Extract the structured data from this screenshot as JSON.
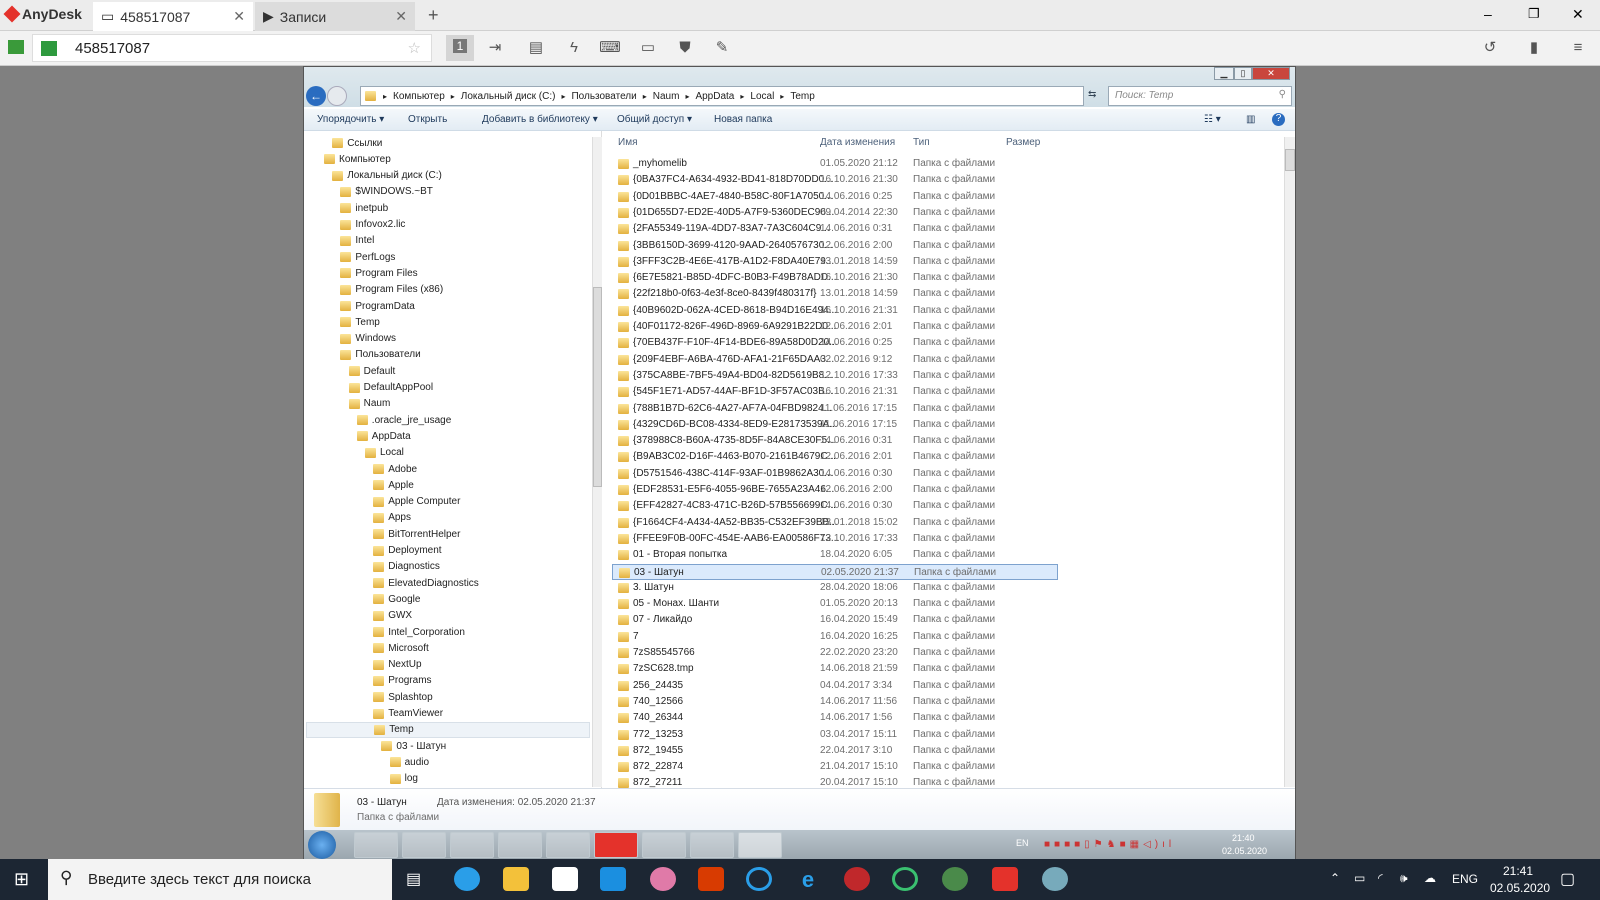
{
  "anydesk": {
    "app_name": "AnyDesk",
    "tabs": [
      {
        "label": "458517087"
      },
      {
        "label": "Записи"
      }
    ],
    "address_value": "458517087",
    "accent": "#e4322b",
    "display_number": "1"
  },
  "explorer": {
    "breadcrumb": [
      "Компьютер",
      "Локальный диск (C:)",
      "Пользователи",
      "Naum",
      "AppData",
      "Local",
      "Temp"
    ],
    "search_placeholder": "Поиск: Temp",
    "commands": [
      "Упорядочить ▾",
      "Открыть",
      "Добавить в библиотеку ▾",
      "Общий доступ ▾",
      "Новая папка"
    ],
    "columns": [
      "Имя",
      "Дата изменения",
      "Тип",
      "Размер"
    ],
    "tree": [
      {
        "label": "Ссылки",
        "depth": 1
      },
      {
        "label": "Компьютер",
        "depth": 0
      },
      {
        "label": "Локальный диск (C:)",
        "depth": 1
      },
      {
        "label": "$WINDOWS.~BT",
        "depth": 2
      },
      {
        "label": "inetpub",
        "depth": 2
      },
      {
        "label": "Infovox2.lic",
        "depth": 2
      },
      {
        "label": "Intel",
        "depth": 2
      },
      {
        "label": "PerfLogs",
        "depth": 2
      },
      {
        "label": "Program Files",
        "depth": 2
      },
      {
        "label": "Program Files (x86)",
        "depth": 2
      },
      {
        "label": "ProgramData",
        "depth": 2
      },
      {
        "label": "Temp",
        "depth": 2
      },
      {
        "label": "Windows",
        "depth": 2
      },
      {
        "label": "Пользователи",
        "depth": 2
      },
      {
        "label": "Default",
        "depth": 3
      },
      {
        "label": "DefaultAppPool",
        "depth": 3
      },
      {
        "label": "Naum",
        "depth": 3
      },
      {
        "label": ".oracle_jre_usage",
        "depth": 4
      },
      {
        "label": "AppData",
        "depth": 4
      },
      {
        "label": "Local",
        "depth": 5
      },
      {
        "label": "Adobe",
        "depth": 6
      },
      {
        "label": "Apple",
        "depth": 6
      },
      {
        "label": "Apple Computer",
        "depth": 6
      },
      {
        "label": "Apps",
        "depth": 6
      },
      {
        "label": "BitTorrentHelper",
        "depth": 6
      },
      {
        "label": "Deployment",
        "depth": 6
      },
      {
        "label": "Diagnostics",
        "depth": 6
      },
      {
        "label": "ElevatedDiagnostics",
        "depth": 6
      },
      {
        "label": "Google",
        "depth": 6
      },
      {
        "label": "GWX",
        "depth": 6
      },
      {
        "label": "Intel_Corporation",
        "depth": 6
      },
      {
        "label": "Microsoft",
        "depth": 6
      },
      {
        "label": "NextUp",
        "depth": 6
      },
      {
        "label": "Programs",
        "depth": 6
      },
      {
        "label": "Splashtop",
        "depth": 6
      },
      {
        "label": "TeamViewer",
        "depth": 6
      },
      {
        "label": "Temp",
        "depth": 6,
        "selected": true
      },
      {
        "label": "03 - Шатун",
        "depth": 7
      },
      {
        "label": "audio",
        "depth": 8
      },
      {
        "label": "log",
        "depth": 8
      }
    ],
    "files": [
      [
        "_myhomelib",
        "01.05.2020 21:12"
      ],
      [
        "{0BA37FC4-A634-4932-BD41-818D70DD0...",
        "16.10.2016 21:30"
      ],
      [
        "{0D01BBBC-4AE7-4840-B58C-80F1A7050...",
        "14.06.2016 0:25"
      ],
      [
        "{01D655D7-ED2E-40D5-A7F9-5360DEC96...",
        "09.04.2014 22:30"
      ],
      [
        "{2FA55349-119A-4DD7-83A7-7A3C604C9...",
        "14.06.2016 0:31"
      ],
      [
        "{3BB6150D-3699-4120-9AAD-2640576730...",
        "12.06.2016 2:00"
      ],
      [
        "{3FFF3C2B-4E6E-417B-A1D2-F8DA40E79...",
        "13.01.2018 14:59"
      ],
      [
        "{6E7E5821-B85D-4DFC-B0B3-F49B78ADD...",
        "16.10.2016 21:30"
      ],
      [
        "{22f218b0-0f63-4e3f-8ce0-8439f480317f}",
        "13.01.2018 14:59"
      ],
      [
        "{40B9602D-062A-4CED-8618-B94D16E494...",
        "16.10.2016 21:31"
      ],
      [
        "{40F01172-826F-496D-8969-6A9291B22D0...",
        "12.06.2016 2:01"
      ],
      [
        "{70EB437F-F10F-4F14-BDE6-89A58D0D20...",
        "14.06.2016 0:25"
      ],
      [
        "{209F4EBF-A6BA-476D-AFA1-21F65DAA3...",
        "02.02.2016 9:12"
      ],
      [
        "{375CA8BE-7BF5-49A4-BD04-82D5619B8...",
        "12.10.2016 17:33"
      ],
      [
        "{545F1E71-AD57-44AF-BF1D-3F57AC03B...",
        "16.10.2016 21:31"
      ],
      [
        "{788B1B7D-62C6-4A27-AF7A-04FBD9824...",
        "11.06.2016 17:15"
      ],
      [
        "{4329CD6D-BC08-4334-8ED9-E28173539A...",
        "11.06.2016 17:15"
      ],
      [
        "{378988C8-B60A-4735-8D5F-84A8CE30F5...",
        "14.06.2016 0:31"
      ],
      [
        "{B9AB3C02-D16F-4463-B070-2161B4679C...",
        "12.06.2016 2:01"
      ],
      [
        "{D5751546-438C-414F-93AF-01B9862A30...",
        "14.06.2016 0:30"
      ],
      [
        "{EDF28531-E5F6-4055-96BE-7655A23A46...",
        "12.06.2016 2:00"
      ],
      [
        "{EFF42827-4C83-471C-B26D-57B556699C...",
        "14.06.2016 0:30"
      ],
      [
        "{F1664CF4-A434-4A52-BB35-C532EF39BB...",
        "13.01.2018 15:02"
      ],
      [
        "{FFEE9F0B-00FC-454E-AAB6-EA00586F73...",
        "12.10.2016 17:33"
      ],
      [
        "01 - Вторая попытка",
        "18.04.2020 6:05"
      ],
      [
        "03 - Шатун",
        "02.05.2020 21:37"
      ],
      [
        "3. Шатун",
        "28.04.2020 18:06"
      ],
      [
        "05 - Монах. Шанти",
        "01.05.2020 20:13"
      ],
      [
        "07 - Ликайдо",
        "16.04.2020 15:49"
      ],
      [
        "7",
        "16.04.2020 16:25"
      ],
      [
        "7zS85545766",
        "22.02.2020 23:20"
      ],
      [
        "7zSC628.tmp",
        "14.06.2018 21:59"
      ],
      [
        "256_24435",
        "04.04.2017 3:34"
      ],
      [
        "740_12566",
        "14.06.2017 11:56"
      ],
      [
        "740_26344",
        "14.06.2017 1:56"
      ],
      [
        "772_13253",
        "03.04.2017 15:11"
      ],
      [
        "872_19455",
        "22.04.2017 3:10"
      ],
      [
        "872_22874",
        "21.04.2017 15:10"
      ],
      [
        "872_27211",
        "20.04.2017 15:10"
      ]
    ],
    "file_type": "Папка с файлами",
    "selected_index": 25,
    "details": {
      "name": "03 - Шатун",
      "type": "Папка с файлами",
      "modified_label": "Дата изменения: 02.05.2020 21:37"
    }
  },
  "remote_taskbar": {
    "lang": "EN",
    "time": "21:40",
    "date": "02.05.2020"
  },
  "taskbar": {
    "search_placeholder": "Введите здесь текст для поиска",
    "lang": "ENG",
    "time": "21:41",
    "date": "02.05.2020"
  }
}
